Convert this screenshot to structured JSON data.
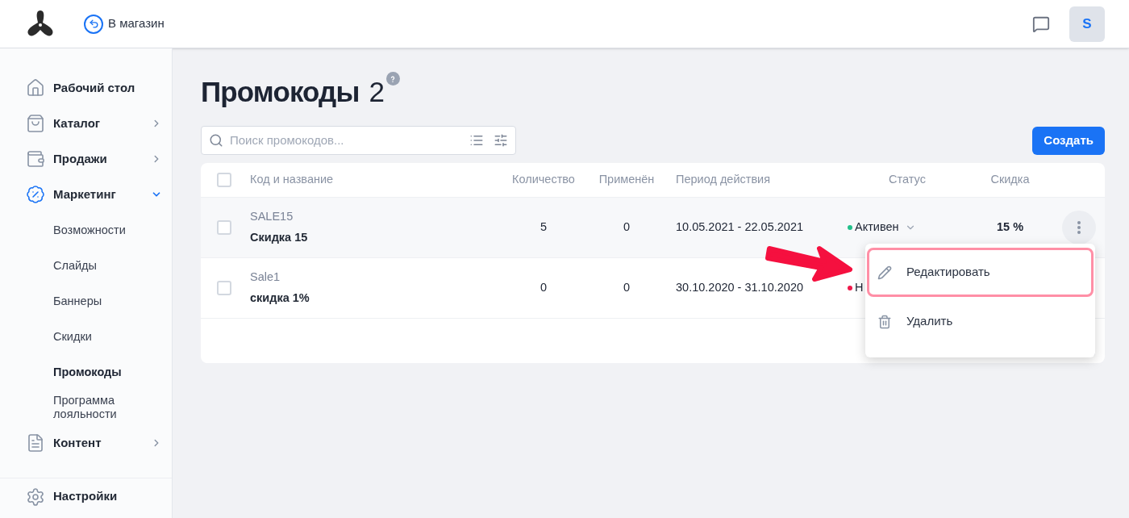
{
  "header": {
    "back_link": "В магазин",
    "avatar": "S"
  },
  "sidebar": {
    "items": [
      {
        "label": "Рабочий стол",
        "kind": "link"
      },
      {
        "label": "Каталог",
        "kind": "group",
        "expanded": false
      },
      {
        "label": "Продажи",
        "kind": "group",
        "expanded": false
      },
      {
        "label": "Маркетинг",
        "kind": "group",
        "expanded": true,
        "children": [
          {
            "label": "Возможности",
            "selected": false
          },
          {
            "label": "Слайды",
            "selected": false
          },
          {
            "label": "Баннеры",
            "selected": false
          },
          {
            "label": "Скидки",
            "selected": false
          },
          {
            "label": "Промокоды",
            "selected": true
          },
          {
            "label": "Программа лояльности",
            "selected": false
          }
        ]
      },
      {
        "label": "Контент",
        "kind": "group",
        "expanded": false
      }
    ],
    "settings": "Настройки"
  },
  "page": {
    "title": "Промокоды",
    "count": "2",
    "search": {
      "placeholder": "Поиск промокодов..."
    },
    "create_button": "Создать"
  },
  "table": {
    "all_checked": false,
    "columns": [
      "Код и название",
      "Количество",
      "Применён",
      "Период действия",
      "Статус",
      "Скидка"
    ],
    "rows": [
      {
        "code": "SALE15",
        "name": "Скидка 15",
        "quantity": "5",
        "applied": "0",
        "period": "10.05.2021 - 22.05.2021",
        "status": "Активен",
        "color": "#22c08a",
        "discount": "15 %",
        "checked": false,
        "hovered": true
      },
      {
        "code": "Sale1",
        "name": "скидка 1%",
        "quantity": "0",
        "applied": "0",
        "period": "30.10.2020 - 31.10.2020",
        "status": "Н",
        "color": "#f0194a",
        "checked": false,
        "hovered": false
      }
    ]
  },
  "context_menu": {
    "items": [
      {
        "label": "Редактировать",
        "highlighted": true
      },
      {
        "label": "Удалить",
        "highlighted": false
      }
    ]
  }
}
